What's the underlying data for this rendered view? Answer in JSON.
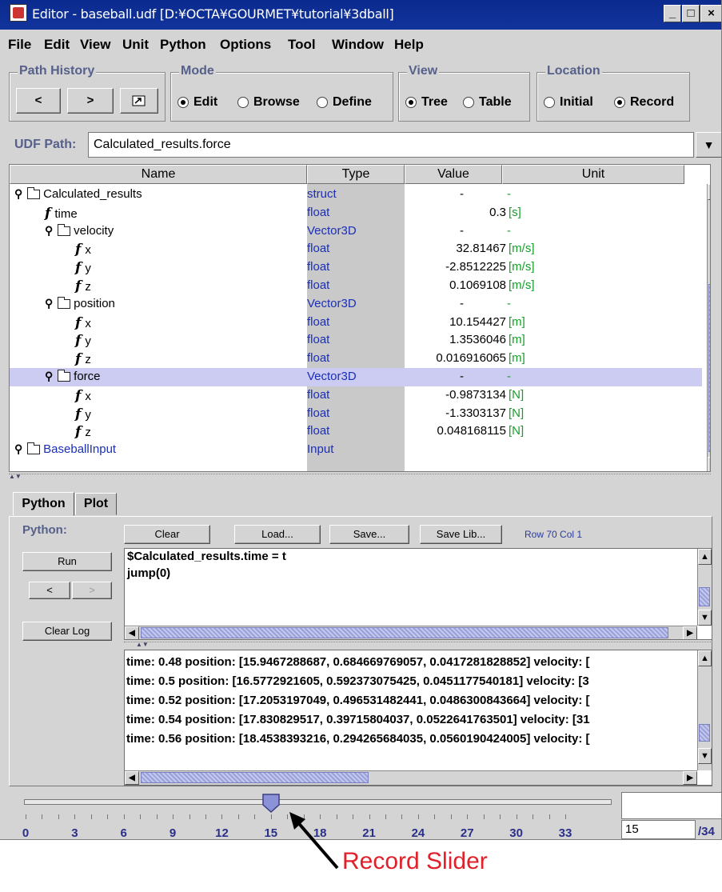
{
  "window": {
    "title": "Editor - baseball.udf [D:¥OCTA¥GOURMET¥tutorial¥3dball]",
    "min": "_",
    "max": "□",
    "close": "×"
  },
  "menu": [
    "File",
    "Edit",
    "View",
    "Unit",
    "Python",
    "Options",
    "Tool",
    "Window",
    "Help"
  ],
  "path_history": {
    "label": "Path History",
    "back": "<",
    "forward": ">"
  },
  "mode": {
    "label": "Mode",
    "options": [
      "Edit",
      "Browse",
      "Define"
    ],
    "selected": "Edit"
  },
  "view": {
    "label": "View",
    "options": [
      "Tree",
      "Table"
    ],
    "selected": "Tree"
  },
  "location": {
    "label": "Location",
    "options": [
      "Initial",
      "Record"
    ],
    "selected": "Record"
  },
  "udf_path": {
    "label": "UDF Path:",
    "value": "Calculated_results.force"
  },
  "table": {
    "headers": [
      "Name",
      "Type",
      "Value",
      "Unit"
    ],
    "rows": [
      {
        "name": "Calculated_results",
        "type": "struct",
        "value": "-",
        "unit": "-"
      },
      {
        "name": "time",
        "type": "float",
        "value": "0.3",
        "unit": "[s]"
      },
      {
        "name": "velocity",
        "type": "Vector3D",
        "value": "-",
        "unit": "-"
      },
      {
        "name": "x",
        "type": "float",
        "value": "32.81467",
        "unit": "[m/s]"
      },
      {
        "name": "y",
        "type": "float",
        "value": "-2.8512225",
        "unit": "[m/s]"
      },
      {
        "name": "z",
        "type": "float",
        "value": "0.1069108",
        "unit": "[m/s]"
      },
      {
        "name": "position",
        "type": "Vector3D",
        "value": "-",
        "unit": "-"
      },
      {
        "name": "x",
        "type": "float",
        "value": "10.154427",
        "unit": "[m]"
      },
      {
        "name": "y",
        "type": "float",
        "value": "1.3536046",
        "unit": "[m]"
      },
      {
        "name": "z",
        "type": "float",
        "value": "0.016916065",
        "unit": "[m]"
      },
      {
        "name": "force",
        "type": "Vector3D",
        "value": "-",
        "unit": "-"
      },
      {
        "name": "x",
        "type": "float",
        "value": "-0.9873134",
        "unit": "[N]"
      },
      {
        "name": "y",
        "type": "float",
        "value": "-1.3303137",
        "unit": "[N]"
      },
      {
        "name": "z",
        "type": "float",
        "value": "0.048168115",
        "unit": "[N]"
      },
      {
        "name": "BaseballInput",
        "type": "Input",
        "value": "",
        "unit": ""
      }
    ]
  },
  "tabs": [
    "Python",
    "Plot"
  ],
  "python": {
    "label": "Python:",
    "clear": "Clear",
    "load": "Load...",
    "save": "Save...",
    "save_lib": "Save Lib...",
    "row_col": "Row 70 Col 1",
    "run": "Run",
    "prev": "<",
    "next": ">",
    "clear_log": "Clear Log",
    "script_lines": [
      "$Calculated_results.time = t",
      "jump(0)"
    ],
    "log_lines": [
      "time: 0.48 position: [15.9467288687, 0.684669769057, 0.0417281828852] velocity: [",
      "time: 0.5 position: [16.5772921605, 0.592373075425, 0.0451177540181] velocity: [3",
      "time: 0.52 position: [17.2053197049, 0.496531482441, 0.0486300843664] velocity: [",
      "time: 0.54 position: [17.830829517, 0.39715804037, 0.0522641763501] velocity: [31",
      "time: 0.56 position: [18.4538393216, 0.294265684035, 0.0560190424005] velocity: ["
    ]
  },
  "slider": {
    "value": 15,
    "min": 0,
    "max": 34,
    "tick_labels": [
      "0",
      "3",
      "6",
      "9",
      "12",
      "15",
      "18",
      "21",
      "24",
      "27",
      "30",
      "33"
    ],
    "current": "15",
    "total": "/34"
  },
  "annotation": "Record Slider"
}
